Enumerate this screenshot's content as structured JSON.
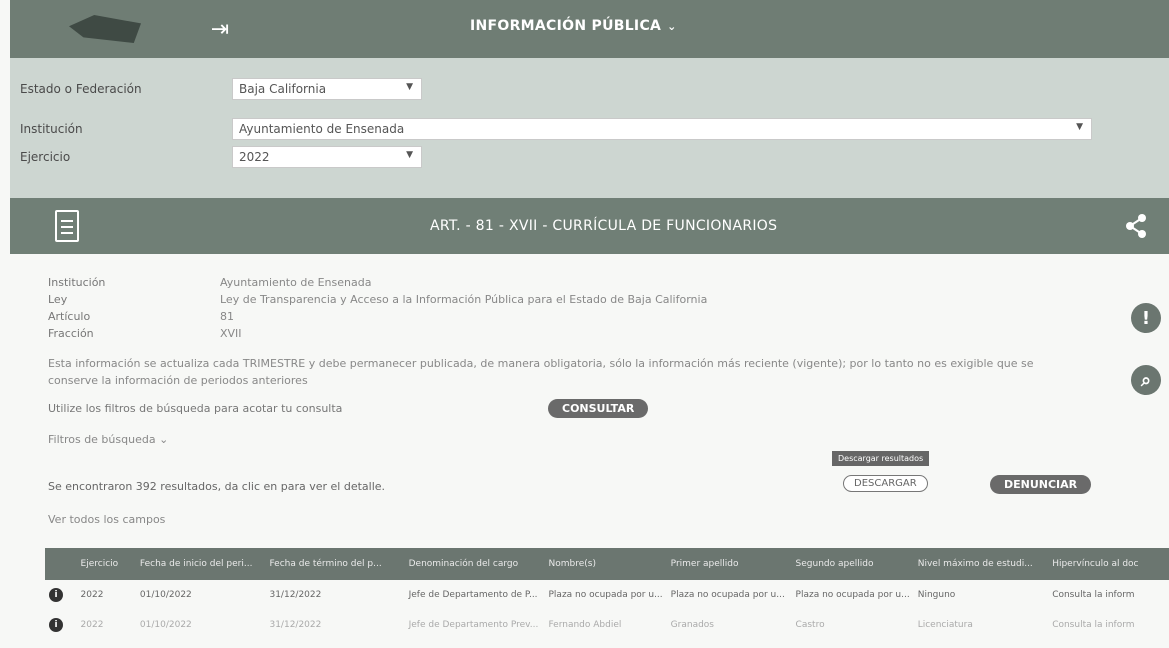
{
  "header": {
    "title": "INFORMACIÓN PÚBLICA"
  },
  "filters": {
    "estado_label": "Estado o Federación",
    "estado_value": "Baja California",
    "institucion_label": "Institución",
    "institucion_value": "Ayuntamiento de Ensenada",
    "ejercicio_label": "Ejercicio",
    "ejercicio_value": "2022"
  },
  "section": {
    "title": "ART. - 81 - XVII - CURRÍCULA DE FUNCIONARIOS"
  },
  "info": {
    "institucion_key": "Institución",
    "institucion_val": "Ayuntamiento de Ensenada",
    "ley_key": "Ley",
    "ley_val": "Ley de Transparencia y Acceso a la Información Pública para el Estado de Baja California",
    "articulo_key": "Artículo",
    "articulo_val": "81",
    "fraccion_key": "Fracción",
    "fraccion_val": "XVII",
    "note": "Esta información se actualiza cada TRIMESTRE y debe permanecer publicada, de manera obligatoria, sólo la información más reciente (vigente); por lo tanto no es exigible que se conserve la información de periodos anteriores"
  },
  "search": {
    "hint": "Utilize los filtros de búsqueda para acotar tu consulta",
    "consultar": "CONSULTAR",
    "filters_toggle": "Filtros de búsqueda",
    "results_text": "Se encontraron 392 resultados, da clic en  para ver el detalle.",
    "tooltip": "Descargar resultados",
    "descargar": "DESCARGAR",
    "denunciar": "DENUNCIAR",
    "all_fields": "Ver todos los campos"
  },
  "table": {
    "headers": [
      "Ejercicio",
      "Fecha de inicio del peri...",
      "Fecha de término del p...",
      "Denominación del cargo",
      "Nombre(s)",
      "Primer apellido",
      "Segundo apellido",
      "Nivel máximo de estudi...",
      "Hipervínculo al doc"
    ],
    "rows": [
      [
        "2022",
        "01/10/2022",
        "31/12/2022",
        "Jefe de Departamento de P...",
        "Plaza no ocupada por u...",
        "Plaza no ocupada por u...",
        "Plaza no ocupada por u...",
        "Ninguno",
        "Consulta la inform"
      ],
      [
        "2022",
        "01/10/2022",
        "31/12/2022",
        "Jefe de Departamento Prev...",
        "Fernando Abdiel",
        "Granados",
        "Castro",
        "Licenciatura",
        "Consulta la inform"
      ]
    ]
  }
}
